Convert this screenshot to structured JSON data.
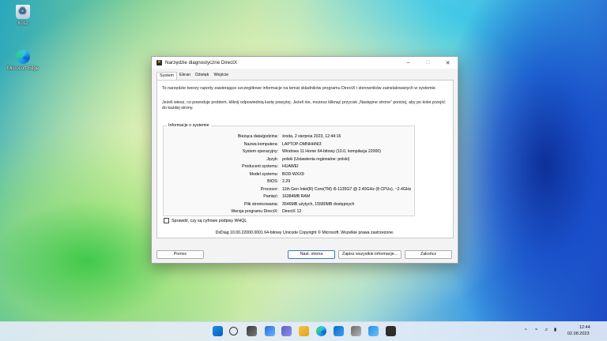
{
  "desktop": {
    "icons": [
      {
        "label": "Kosz"
      },
      {
        "label": "Microsoft Edge"
      }
    ]
  },
  "window": {
    "title": "Narzędzie diagnostyczne DirectX",
    "tabs": [
      "System",
      "Ekran",
      "Dźwięk",
      "Wejście"
    ],
    "intro1": "To narzędzie tworzy raporty zawierające szczegółowe informacje na temat składników programu DirectX i sterowników zainstalowanych w systemie.",
    "intro2": "Jeżeli wiesz, co powoduje problem, kliknij odpowiednią kartę powyżej. Jeżeli nie, możesz kliknąć przycisk „Następne strone” poniżej, aby po kolei przejść do każdej strony.",
    "group_label": "Informacje o systemie",
    "info": [
      {
        "label": "Bieżąca data/godzina:",
        "value": "środa, 2 sierpnia 2023, 12:44:16"
      },
      {
        "label": "Nazwa komputera:",
        "value": "LAPTOP-DMNHHNI3"
      },
      {
        "label": "System operacyjny:",
        "value": "Windows 11 Home 64-bitowy (10.0, kompilacja 22000)"
      },
      {
        "label": "Język:",
        "value": "polski (Ustawienia regionalne: polski)"
      },
      {
        "label": "Producent systemu:",
        "value": "HUAWEI"
      },
      {
        "label": "Model systemu:",
        "value": "BOD-WXX9"
      },
      {
        "label": "BIOS:",
        "value": "2.29"
      },
      {
        "label": "Procesor:",
        "value": "11th Gen Intel(R) Core(TM) i5-1135G7 @ 2.40GHz (8 CPUs), ~2.4GHz"
      },
      {
        "label": "Pamięć:",
        "value": "16384MB RAM"
      },
      {
        "label": "Plik stronicowania:",
        "value": "3546MB użytych, 15580MB dostępnych"
      },
      {
        "label": "Wersja programu DirectX:",
        "value": "DirectX 12"
      }
    ],
    "checkbox_label": "Sprawdź, czy są cyfrowe podpisy WHQL",
    "footer": "DxDiag 10.00.22000.0001 64-bitowy Unicode  Copyright © Microsoft. Wszelkie prawa zastrzeżone.",
    "buttons": {
      "help": "Pomoc",
      "next": "Nast. strona",
      "save": "Zapisz wszystkie informacje...",
      "close": "Zakończ"
    }
  },
  "taskbar": {
    "time": "12:44",
    "date": "02.08.2023"
  },
  "colors": {
    "accent": "#3a79c9",
    "taskbar": "#e4ecf6"
  }
}
